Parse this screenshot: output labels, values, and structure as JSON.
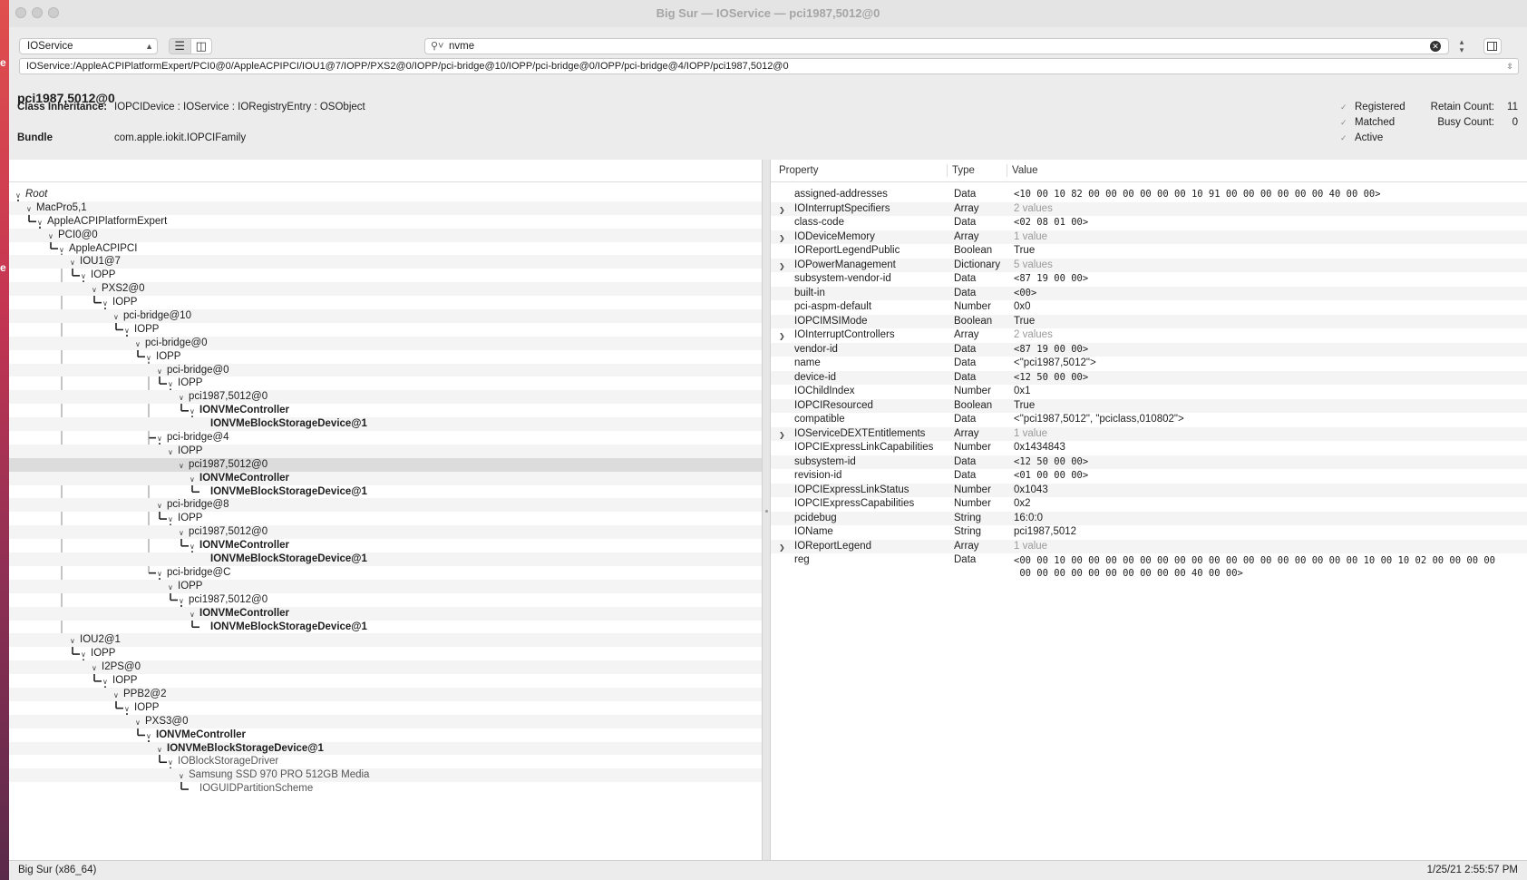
{
  "window": {
    "title": "Big Sur — IOService — pci1987,5012@0"
  },
  "toolbar": {
    "plane": "IOService",
    "search_text": "nvme",
    "path": "IOService:/AppleACPIPlatformExpert/PCI0@0/AppleACPIPCI/IOU1@7/IOPP/PXS2@0/IOPP/pci-bridge@10/IOPP/pci-bridge@0/IOPP/pci-bridge@4/IOPP/pci1987,5012@0"
  },
  "info": {
    "object_name": "pci1987,5012@0",
    "class_label": "Class Inheritance:",
    "class_value": "IOPCIDevice : IOService : IORegistryEntry : OSObject",
    "bundle_label": "Bundle",
    "bundle_value": "com.apple.iokit.IOPCIFamily",
    "registered": "Registered",
    "matched": "Matched",
    "active": "Active",
    "retain_label": "Retain Count:",
    "retain_value": "11",
    "busy_label": "Busy Count:",
    "busy_value": "0"
  },
  "tree": [
    {
      "d": 0,
      "t": "Root",
      "s": "ital"
    },
    {
      "d": 1,
      "t": "MacPro5,1"
    },
    {
      "d": 2,
      "t": "AppleACPIPlatformExpert"
    },
    {
      "d": 3,
      "t": "PCI0@0"
    },
    {
      "d": 4,
      "t": "AppleACPIPCI"
    },
    {
      "d": 5,
      "t": "IOU1@7"
    },
    {
      "d": 6,
      "t": "IOPP"
    },
    {
      "d": 7,
      "t": "PXS2@0"
    },
    {
      "d": 8,
      "t": "IOPP"
    },
    {
      "d": 9,
      "t": "pci-bridge@10"
    },
    {
      "d": 10,
      "t": "IOPP"
    },
    {
      "d": 11,
      "t": "pci-bridge@0"
    },
    {
      "d": 12,
      "t": "IOPP"
    },
    {
      "d": 13,
      "t": "pci-bridge@0"
    },
    {
      "d": 14,
      "t": "IOPP"
    },
    {
      "d": 15,
      "t": "pci1987,5012@0"
    },
    {
      "d": 16,
      "t": "IONVMeController",
      "s": "bold"
    },
    {
      "d": 17,
      "t": "IONVMeBlockStorageDevice@1",
      "s": "bold",
      "leaf": true
    },
    {
      "d": 13,
      "t": "pci-bridge@4"
    },
    {
      "d": 14,
      "t": "IOPP"
    },
    {
      "d": 15,
      "t": "pci1987,5012@0",
      "sel": true
    },
    {
      "d": 16,
      "t": "IONVMeController",
      "s": "bold"
    },
    {
      "d": 17,
      "t": "IONVMeBlockStorageDevice@1",
      "s": "bold",
      "leaf": true
    },
    {
      "d": 13,
      "t": "pci-bridge@8"
    },
    {
      "d": 14,
      "t": "IOPP"
    },
    {
      "d": 15,
      "t": "pci1987,5012@0"
    },
    {
      "d": 16,
      "t": "IONVMeController",
      "s": "bold"
    },
    {
      "d": 17,
      "t": "IONVMeBlockStorageDevice@1",
      "s": "bold",
      "leaf": true
    },
    {
      "d": 13,
      "t": "pci-bridge@C"
    },
    {
      "d": 14,
      "t": "IOPP"
    },
    {
      "d": 15,
      "t": "pci1987,5012@0"
    },
    {
      "d": 16,
      "t": "IONVMeController",
      "s": "bold"
    },
    {
      "d": 17,
      "t": "IONVMeBlockStorageDevice@1",
      "s": "bold",
      "leaf": true
    },
    {
      "d": 5,
      "t": "IOU2@1"
    },
    {
      "d": 6,
      "t": "IOPP"
    },
    {
      "d": 7,
      "t": "I2PS@0"
    },
    {
      "d": 8,
      "t": "IOPP"
    },
    {
      "d": 9,
      "t": "PPB2@2"
    },
    {
      "d": 10,
      "t": "IOPP"
    },
    {
      "d": 11,
      "t": "PXS3@0"
    },
    {
      "d": 12,
      "t": "IONVMeController",
      "s": "bold"
    },
    {
      "d": 13,
      "t": "IONVMeBlockStorageDevice@1",
      "s": "bold"
    },
    {
      "d": 14,
      "t": "IOBlockStorageDriver",
      "s": "grey"
    },
    {
      "d": 15,
      "t": "Samsung SSD 970 PRO 512GB Media",
      "s": "grey"
    },
    {
      "d": 16,
      "t": "IOGUIDPartitionScheme",
      "s": "grey",
      "leaf": true
    }
  ],
  "props_header": {
    "property": "Property",
    "type": "Type",
    "value": "Value"
  },
  "properties": [
    {
      "n": "assigned-addresses",
      "t": "Data",
      "v": "<10 00 10 82 00 00 00 00 00 00 10 91 00 00 00 00 00 00 40 00 00>",
      "mono": true
    },
    {
      "n": "IOInterruptSpecifiers",
      "t": "Array",
      "v": "2 values",
      "grey": true,
      "disc": true
    },
    {
      "n": "class-code",
      "t": "Data",
      "v": "<02 08 01 00>",
      "mono": true
    },
    {
      "n": "IODeviceMemory",
      "t": "Array",
      "v": "1 value",
      "grey": true,
      "disc": true
    },
    {
      "n": "IOReportLegendPublic",
      "t": "Boolean",
      "v": "True"
    },
    {
      "n": "IOPowerManagement",
      "t": "Dictionary",
      "v": "5 values",
      "grey": true,
      "disc": true
    },
    {
      "n": "subsystem-vendor-id",
      "t": "Data",
      "v": "<87 19 00 00>",
      "mono": true
    },
    {
      "n": "built-in",
      "t": "Data",
      "v": "<00>",
      "mono": true
    },
    {
      "n": "pci-aspm-default",
      "t": "Number",
      "v": "0x0"
    },
    {
      "n": "IOPCIMSIMode",
      "t": "Boolean",
      "v": "True"
    },
    {
      "n": "IOInterruptControllers",
      "t": "Array",
      "v": "2 values",
      "grey": true,
      "disc": true
    },
    {
      "n": "vendor-id",
      "t": "Data",
      "v": "<87 19 00 00>",
      "mono": true
    },
    {
      "n": "name",
      "t": "Data",
      "v": "<\"pci1987,5012\">"
    },
    {
      "n": "device-id",
      "t": "Data",
      "v": "<12 50 00 00>",
      "mono": true
    },
    {
      "n": "IOChildIndex",
      "t": "Number",
      "v": "0x1"
    },
    {
      "n": "IOPCIResourced",
      "t": "Boolean",
      "v": "True"
    },
    {
      "n": "compatible",
      "t": "Data",
      "v": "<\"pci1987,5012\", \"pciclass,010802\">"
    },
    {
      "n": "IOServiceDEXTEntitlements",
      "t": "Array",
      "v": "1 value",
      "grey": true,
      "disc": true
    },
    {
      "n": "IOPCIExpressLinkCapabilities",
      "t": "Number",
      "v": "0x1434843"
    },
    {
      "n": "subsystem-id",
      "t": "Data",
      "v": "<12 50 00 00>",
      "mono": true
    },
    {
      "n": "revision-id",
      "t": "Data",
      "v": "<01 00 00 00>",
      "mono": true
    },
    {
      "n": "IOPCIExpressLinkStatus",
      "t": "Number",
      "v": "0x1043"
    },
    {
      "n": "IOPCIExpressCapabilities",
      "t": "Number",
      "v": "0x2"
    },
    {
      "n": "pcidebug",
      "t": "String",
      "v": "16:0:0"
    },
    {
      "n": "IOName",
      "t": "String",
      "v": "pci1987,5012"
    },
    {
      "n": "IOReportLegend",
      "t": "Array",
      "v": "1 value",
      "grey": true,
      "disc": true
    },
    {
      "n": "reg",
      "t": "Data",
      "v": "<00 00 10 00 00 00 00 00 00 00 00 00 00 00 00 00 00 00 00 00 10 00 10 02 00 00 00 00\n 00 00 00 00 00 00 00 00 00 00 40 00 00>",
      "mono": true,
      "tall": true
    }
  ],
  "status": {
    "left": "Big Sur (x86_64)",
    "right": "1/25/21 2:55:57 PM"
  }
}
